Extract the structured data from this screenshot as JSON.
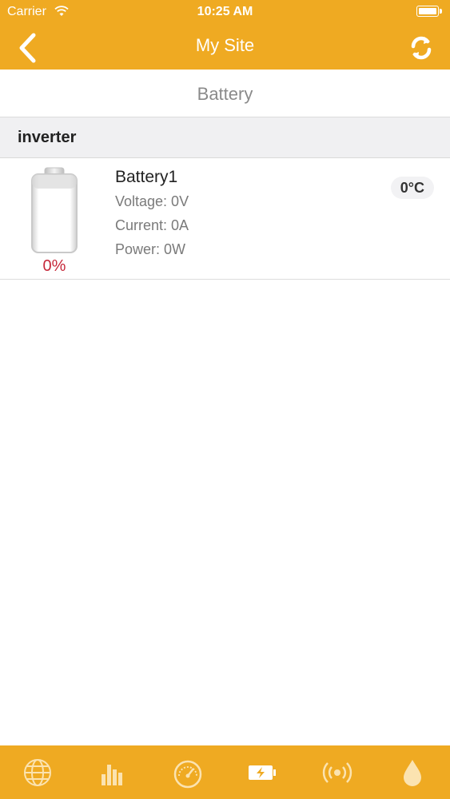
{
  "status_bar": {
    "carrier": "Carrier",
    "time": "10:25 AM"
  },
  "nav": {
    "title": "My Site"
  },
  "segment": {
    "label": "Battery"
  },
  "section": {
    "title": "inverter"
  },
  "battery": {
    "name": "Battery1",
    "voltage": "Voltage: 0V",
    "current": "Current: 0A",
    "power": "Power: 0W",
    "percent": "0%",
    "temperature": "0°C"
  },
  "tabs": [
    {
      "icon": "globe-icon"
    },
    {
      "icon": "bar-chart-icon"
    },
    {
      "icon": "gauge-icon"
    },
    {
      "icon": "battery-charging-icon",
      "active": true
    },
    {
      "icon": "signal-broadcast-icon"
    },
    {
      "icon": "water-drop-icon"
    }
  ],
  "colors": {
    "accent": "#EFAA22",
    "percent": "#C6283A"
  }
}
